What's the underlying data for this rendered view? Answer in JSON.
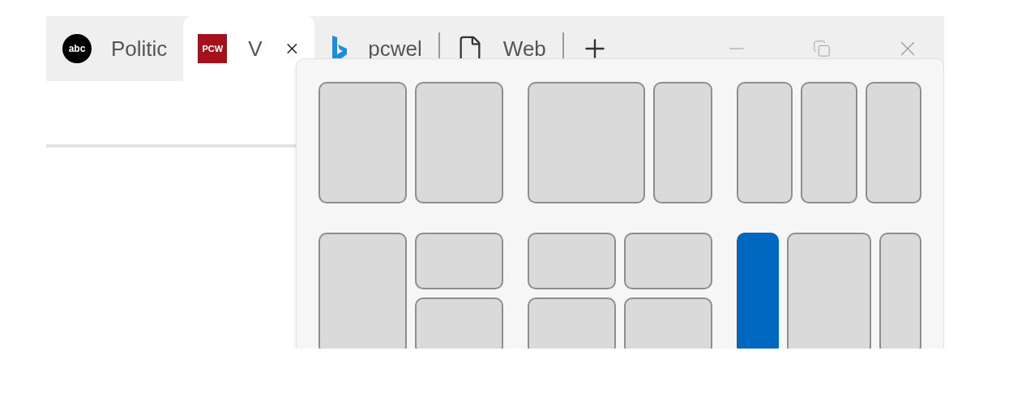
{
  "tabs": [
    {
      "label": "Politic",
      "favicon": {
        "kind": "circle-text",
        "text": "abc"
      },
      "selected": false,
      "closable": false
    },
    {
      "label": "V",
      "favicon": {
        "kind": "square-text",
        "text": "PCW"
      },
      "selected": true,
      "closable": true
    },
    {
      "label": "pcwel",
      "favicon": {
        "kind": "bing"
      },
      "selected": false,
      "closable": false
    },
    {
      "label": "Web",
      "favicon": {
        "kind": "page"
      },
      "selected": false,
      "closable": false
    }
  ],
  "snap_layouts": [
    {
      "kind": "halves",
      "zones": [
        {
          "selected": false
        },
        {
          "selected": false
        }
      ]
    },
    {
      "kind": "wide-left",
      "zones": [
        {
          "selected": false
        },
        {
          "selected": false
        }
      ]
    },
    {
      "kind": "thirds",
      "zones": [
        {
          "selected": false
        },
        {
          "selected": false
        },
        {
          "selected": false
        }
      ]
    },
    {
      "kind": "left-and-stack",
      "zones": [
        {
          "selected": false
        },
        {
          "selected": false
        },
        {
          "selected": false
        }
      ]
    },
    {
      "kind": "quad",
      "zones": [
        {
          "selected": false
        },
        {
          "selected": false
        },
        {
          "selected": false
        },
        {
          "selected": false
        }
      ]
    },
    {
      "kind": "wide-center",
      "zones": [
        {
          "selected": true
        },
        {
          "selected": false
        },
        {
          "selected": false
        }
      ]
    }
  ]
}
